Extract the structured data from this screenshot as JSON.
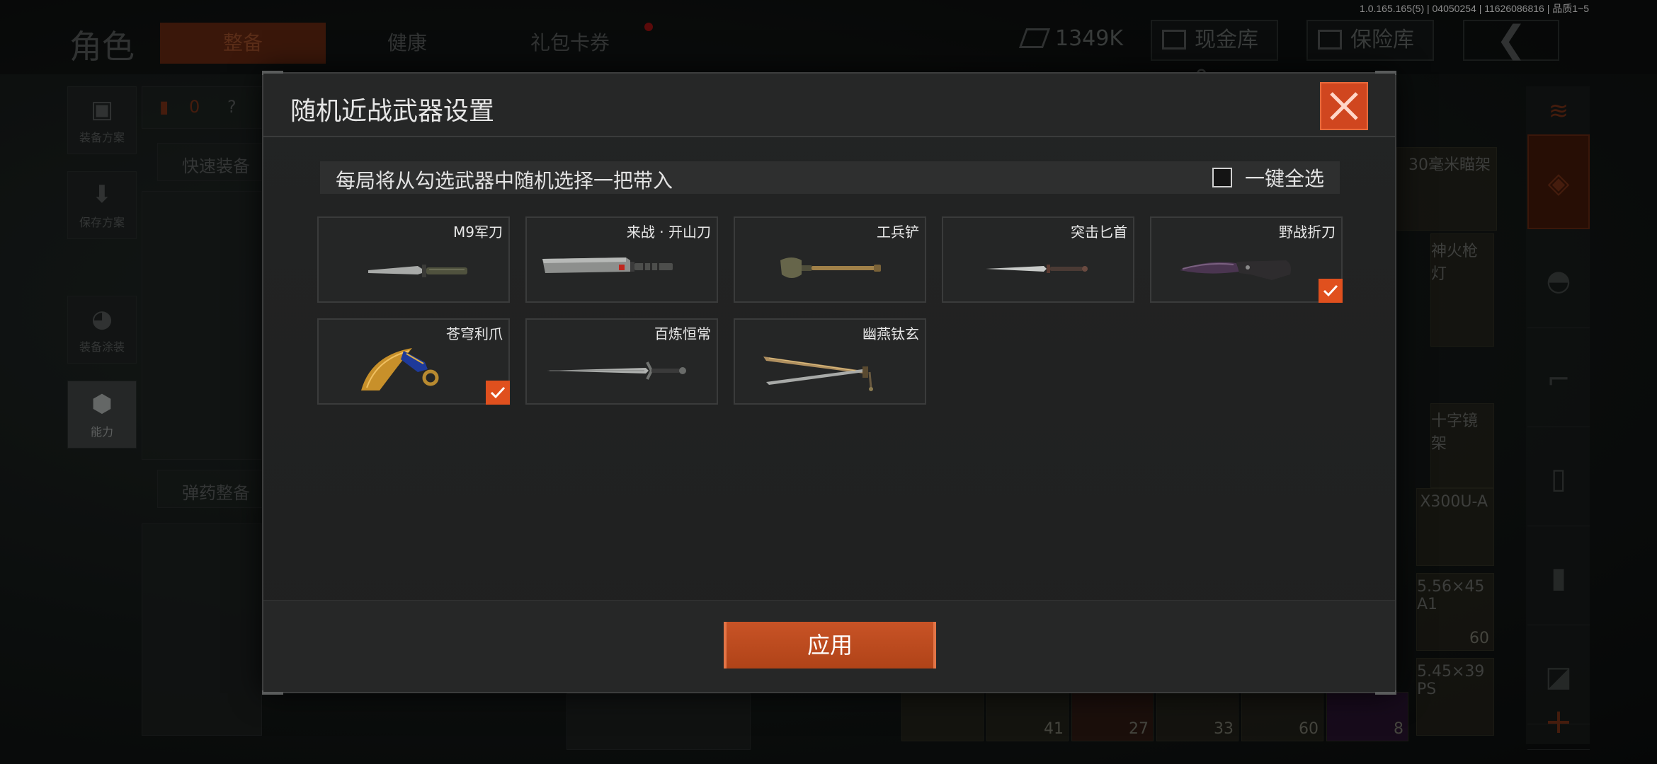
{
  "app": {
    "version": "1.0.165.165(5) | 04050254 | 11626086816 | 品质1~5"
  },
  "background": {
    "page_title": "角色",
    "tabs": [
      {
        "label": "整备",
        "active": true
      },
      {
        "label": "健康",
        "active": false
      },
      {
        "label": "礼包卡券",
        "active": false
      }
    ],
    "currency": "1349K",
    "cash_vault": "现金库 0",
    "safe_vault": "保险库",
    "sidebar": [
      {
        "label": "装备方案",
        "icon": "vest-icon"
      },
      {
        "label": "保存方案",
        "icon": "download-icon"
      },
      {
        "label": "装备涂装",
        "icon": "helmet-icon"
      },
      {
        "label": "能力",
        "icon": "ability-icon",
        "active": true
      }
    ],
    "loadout_count": "0",
    "help_icon": "?",
    "quick_equip": "快速装备",
    "ammo_equip": "弹药整备",
    "inventory": [
      {
        "name": "30毫米瞄架",
        "count": ""
      },
      {
        "name": "神火枪灯",
        "count": ""
      },
      {
        "name": "十字镜架",
        "count": ""
      },
      {
        "name": "X300U-A",
        "count": ""
      },
      {
        "name": "5.56×45 A1",
        "count": "60"
      },
      {
        "name": "5.45×39 PS",
        "count": ""
      }
    ],
    "ammo_counts": [
      "41",
      "27",
      "33",
      "60",
      "8"
    ]
  },
  "modal": {
    "title": "随机近战武器设置",
    "info": "每局将从勾选武器中随机选择一把带入",
    "select_all_label": "一键全选",
    "select_all_checked": false,
    "apply_label": "应用",
    "accent_color": "#d0461f",
    "weapons": [
      {
        "name": "M9军刀",
        "checked": false
      },
      {
        "name": "来战 · 开山刀",
        "checked": false
      },
      {
        "name": "工兵铲",
        "checked": false
      },
      {
        "name": "突击匕首",
        "checked": false
      },
      {
        "name": "野战折刀",
        "checked": true
      },
      {
        "name": "苍穹利爪",
        "checked": true
      },
      {
        "name": "百炼恒常",
        "checked": false
      },
      {
        "name": "幽燕钛玄",
        "checked": false
      }
    ]
  }
}
